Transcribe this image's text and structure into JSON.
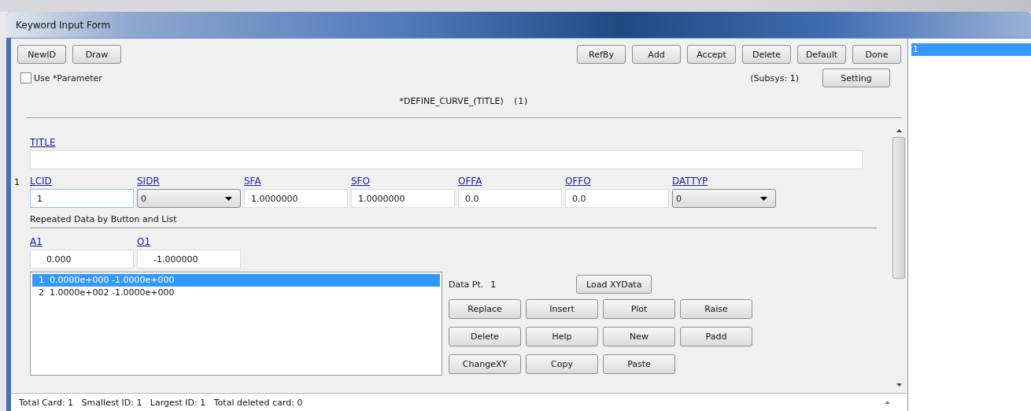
{
  "window": {
    "title": "Keyword Input Form"
  },
  "toolbar": {
    "left_buttons": [
      "NewID",
      "Draw"
    ],
    "right_buttons": [
      "RefBy",
      "Add",
      "Accept",
      "Delete",
      "Default",
      "Done"
    ]
  },
  "use_parameter": {
    "label": "Use *Parameter",
    "checked": false
  },
  "subsys": "(Subsys: 1)",
  "setting_button": "Setting",
  "keyword": {
    "name": "*DEFINE_CURVE_(TITLE)",
    "count": "(1)"
  },
  "title_field": {
    "label": "TITLE"
  },
  "card": {
    "number": "1",
    "fields": [
      {
        "label": "LCID",
        "kind": "input",
        "value": "1",
        "focused": true
      },
      {
        "label": "SIDR",
        "kind": "select",
        "value": "0",
        "focused": false
      },
      {
        "label": "SFA",
        "kind": "input",
        "value": "1.0000000",
        "focused": false
      },
      {
        "label": "SFO",
        "kind": "input",
        "value": "1.0000000",
        "focused": false
      },
      {
        "label": "OFFA",
        "kind": "input",
        "value": "0.0",
        "focused": false
      },
      {
        "label": "OFFO",
        "kind": "input",
        "value": "0.0",
        "focused": false
      },
      {
        "label": "DATTYP",
        "kind": "select",
        "value": "0",
        "focused": false
      }
    ]
  },
  "repeated": {
    "heading": "Repeated Data by Button and List",
    "fields": [
      {
        "label": "A1",
        "value": "0.000"
      },
      {
        "label": "O1",
        "value": "-1.000000"
      }
    ],
    "rows": [
      {
        "index": "1",
        "text": "0.0000e+000 -1.0000e+000",
        "selected": true
      },
      {
        "index": "2",
        "text": "1.0000e+002 -1.0000e+000",
        "selected": false
      }
    ],
    "data_pt": {
      "label": "Data Pt.",
      "value": "1"
    },
    "load_button": "Load XYData",
    "buttons": [
      "Replace",
      "Insert",
      "Plot",
      "Raise",
      "Delete",
      "Help",
      "New",
      "Padd",
      "ChangeXY",
      "Copy",
      "Paste"
    ]
  },
  "side_list": {
    "items": [
      {
        "label": "1",
        "selected": true
      }
    ]
  },
  "status_bar": "Total Card: 1   Smallest ID: 1   Largest ID: 1   Total deleted card: 0"
}
